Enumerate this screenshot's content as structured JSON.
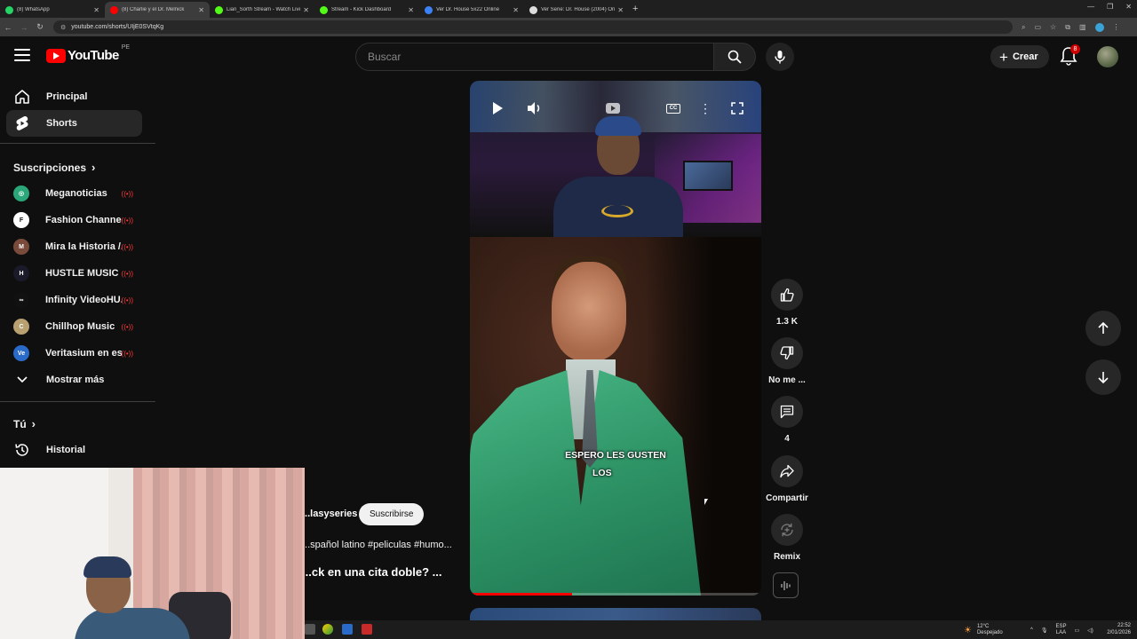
{
  "browser": {
    "tabs": [
      {
        "label": "(8) WhatsApp",
        "color": "#25d366",
        "active": false
      },
      {
        "label": "(8) Charlie y el Dr. Melnick",
        "color": "#ff0000",
        "active": true
      },
      {
        "label": "Lian_Sorth Stream - Watch Live",
        "color": "#53fc18",
        "active": false
      },
      {
        "label": "Stream - Kick Dashboard",
        "color": "#53fc18",
        "active": false
      },
      {
        "label": "Ver Dr. House 5x22 Online",
        "color": "#3b82f6",
        "active": false
      },
      {
        "label": "Ver Serie: Dr. House (2004) Onl",
        "color": "#dddddd",
        "active": false
      }
    ],
    "url": "youtube.com/shorts/UIjE0SVtqKg"
  },
  "header": {
    "logo_text": "YouTube",
    "country": "PE",
    "search_placeholder": "Buscar",
    "create_label": "Crear",
    "notification_count": "8"
  },
  "sidebar": {
    "main_items": [
      {
        "label": "Principal",
        "icon": "home-icon"
      },
      {
        "label": "Shorts",
        "icon": "shorts-icon"
      }
    ],
    "subscriptions_heading": "Suscripciones",
    "channels": [
      {
        "name": "Meganoticias",
        "bg": "#2aa87a",
        "fg": "#ffffff",
        "mark": "◎"
      },
      {
        "name": "Fashion Channel",
        "bg": "#ffffff",
        "fg": "#111111",
        "mark": "F"
      },
      {
        "name": "Mira la Historia /...",
        "bg": "#7a4a3a",
        "fg": "#ffffff",
        "mark": "M"
      },
      {
        "name": "HUSTLE MUSIC (...",
        "bg": "#1a1a2a",
        "fg": "#ffffff",
        "mark": "H"
      },
      {
        "name": "Infinity VideoHU...",
        "bg": "#111111",
        "fg": "#ffffff",
        "mark": "∞"
      },
      {
        "name": "Chillhop Music",
        "bg": "#b8a070",
        "fg": "#ffffff",
        "mark": "C"
      },
      {
        "name": "Veritasium en espa...",
        "bg": "#2a6ac8",
        "fg": "#ffffff",
        "mark": "Ve"
      }
    ],
    "show_more": "Mostrar más",
    "you_heading": "Tú",
    "history": "Historial"
  },
  "short": {
    "caption_line1": "ESPERO LES GUSTEN",
    "caption_line2": "LOS",
    "progress": 0.35,
    "channel": "...lasyseries",
    "subscribe_label": "Suscribirse",
    "tags": "...spañol latino #peliculas #humo...",
    "title": "...ck en una cita doble? ..."
  },
  "actions": {
    "likes": "1.3 K",
    "dislike_label": "No me ...",
    "comments": "4",
    "share_label": "Compartir",
    "remix_label": "Remix"
  },
  "taskbar": {
    "temperature": "12°C",
    "weather": "Despejado",
    "lang1": "ESP",
    "lang2": "LAA",
    "time": "22:52",
    "date": "2/01/2026"
  }
}
